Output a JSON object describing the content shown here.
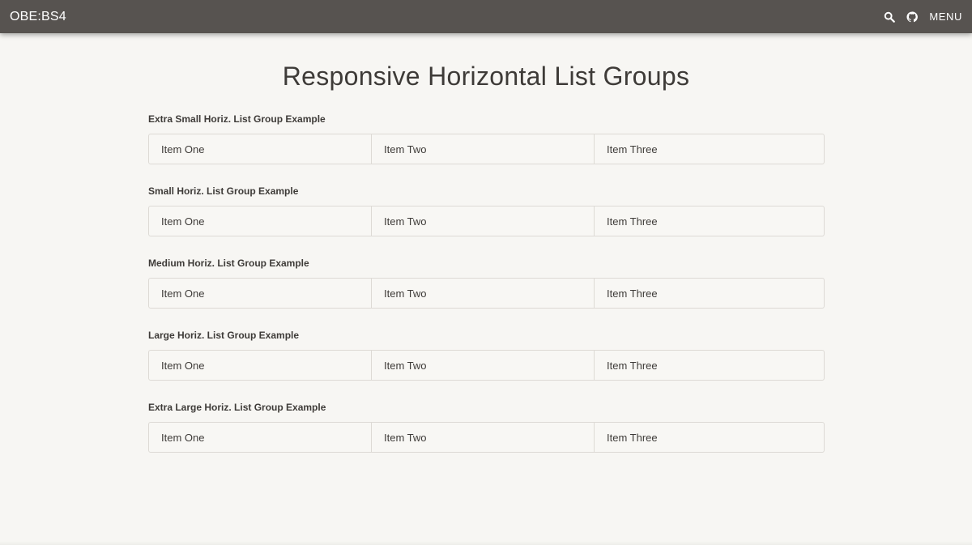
{
  "navbar": {
    "brand": "OBE:BS4",
    "search_icon": "search-icon",
    "github_icon": "github-icon",
    "menu_label": "MENU"
  },
  "page": {
    "title": "Responsive Horizontal List Groups"
  },
  "sections": [
    {
      "heading": "Extra Small Horiz. List Group Example",
      "items": [
        "Item One",
        "Item Two",
        "Item Three"
      ]
    },
    {
      "heading": "Small Horiz. List Group Example",
      "items": [
        "Item One",
        "Item Two",
        "Item Three"
      ]
    },
    {
      "heading": "Medium Horiz. List Group Example",
      "items": [
        "Item One",
        "Item Two",
        "Item Three"
      ]
    },
    {
      "heading": "Large Horiz. List Group Example",
      "items": [
        "Item One",
        "Item Two",
        "Item Three"
      ]
    },
    {
      "heading": "Extra Large Horiz. List Group Example",
      "items": [
        "Item One",
        "Item Two",
        "Item Three"
      ]
    }
  ],
  "colors": {
    "navbar_bg": "#575350",
    "page_bg": "#f7f6f3",
    "text": "#3e3b38",
    "border": "#dddad5"
  }
}
